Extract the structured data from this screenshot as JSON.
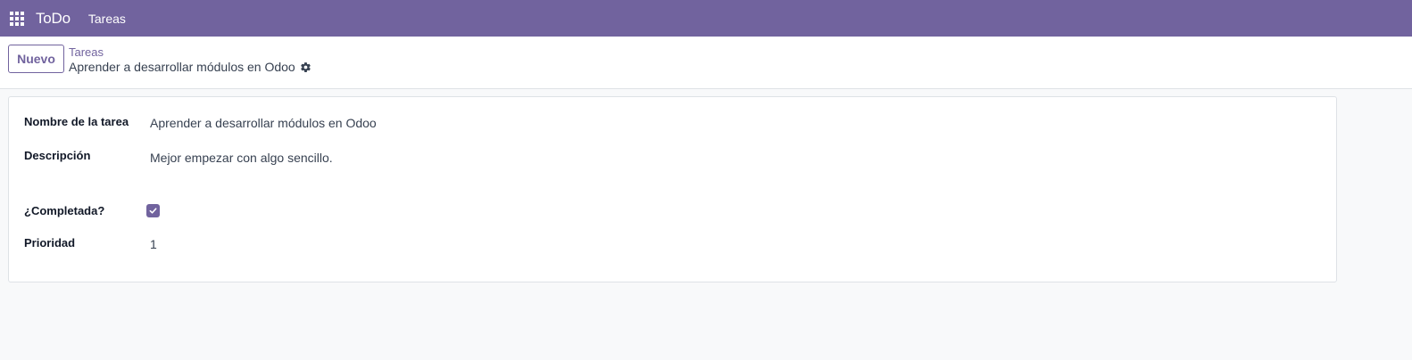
{
  "navbar": {
    "apps_icon": "grid-icon",
    "app_name": "ToDo",
    "menu": [
      {
        "label": "Tareas"
      }
    ]
  },
  "control_panel": {
    "new_label": "Nuevo",
    "breadcrumb": {
      "parent": "Tareas",
      "current": "Aprender a desarrollar módulos en Odoo",
      "settings_icon": "gear-icon"
    }
  },
  "form": {
    "fields": [
      {
        "label": "Nombre de la tarea",
        "value": "Aprender a desarrollar módulos en Odoo"
      },
      {
        "label": "Descripción",
        "value": "Mejor empezar con algo sencillo."
      },
      {
        "label": "¿Completada?",
        "checked": true
      },
      {
        "label": "Prioridad",
        "value": "1"
      }
    ]
  },
  "colors": {
    "brand": "#71639e",
    "background": "#f8f9fa",
    "border": "#dee2e6"
  }
}
